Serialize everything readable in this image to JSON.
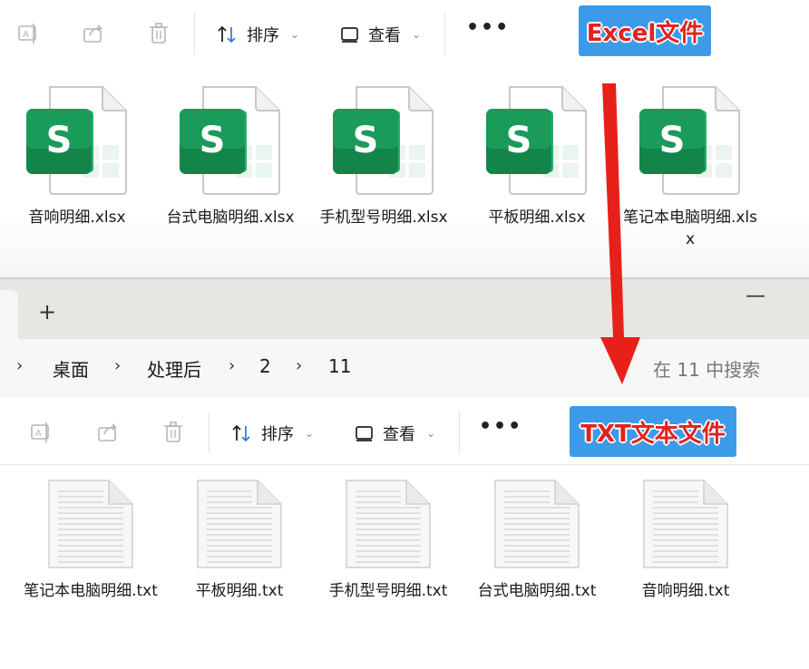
{
  "top_window": {
    "toolbar": {
      "sort_label": "排序",
      "view_label": "查看",
      "more_label": "•••"
    },
    "badge_label": "Excel文件",
    "files": [
      {
        "name": "音响明细.xlsx",
        "icon": "xlsx-file-icon"
      },
      {
        "name": "台式电脑明细.xlsx",
        "icon": "xlsx-file-icon"
      },
      {
        "name": "手机型号明细.xlsx",
        "icon": "xlsx-file-icon"
      },
      {
        "name": "平板明细.xlsx",
        "icon": "xlsx-file-icon"
      },
      {
        "name": "笔记本电脑明细.xlsx",
        "icon": "xlsx-file-icon"
      }
    ]
  },
  "middle_window": {
    "new_tab_label": "+",
    "minimize_label": "—",
    "breadcrumbs": [
      "桌面",
      "处理后",
      "2",
      "11"
    ],
    "search_placeholder": "在 11 中搜索"
  },
  "bottom_window": {
    "toolbar": {
      "sort_label": "排序",
      "view_label": "查看",
      "more_label": "•••"
    },
    "badge_label": "TXT文本文件",
    "files": [
      {
        "name": "笔记本电脑明细.txt",
        "icon": "txt-file-icon"
      },
      {
        "name": "平板明细.txt",
        "icon": "txt-file-icon"
      },
      {
        "name": "手机型号明细.txt",
        "icon": "txt-file-icon"
      },
      {
        "name": "台式电脑明细.txt",
        "icon": "txt-file-icon"
      },
      {
        "name": "音响明细.txt",
        "icon": "txt-file-icon"
      }
    ]
  },
  "colors": {
    "badge_bg": "#3d9ae8",
    "badge_text": "#e0231e",
    "arrow": "#e8201a",
    "excel_green": "#1a9b5a"
  }
}
